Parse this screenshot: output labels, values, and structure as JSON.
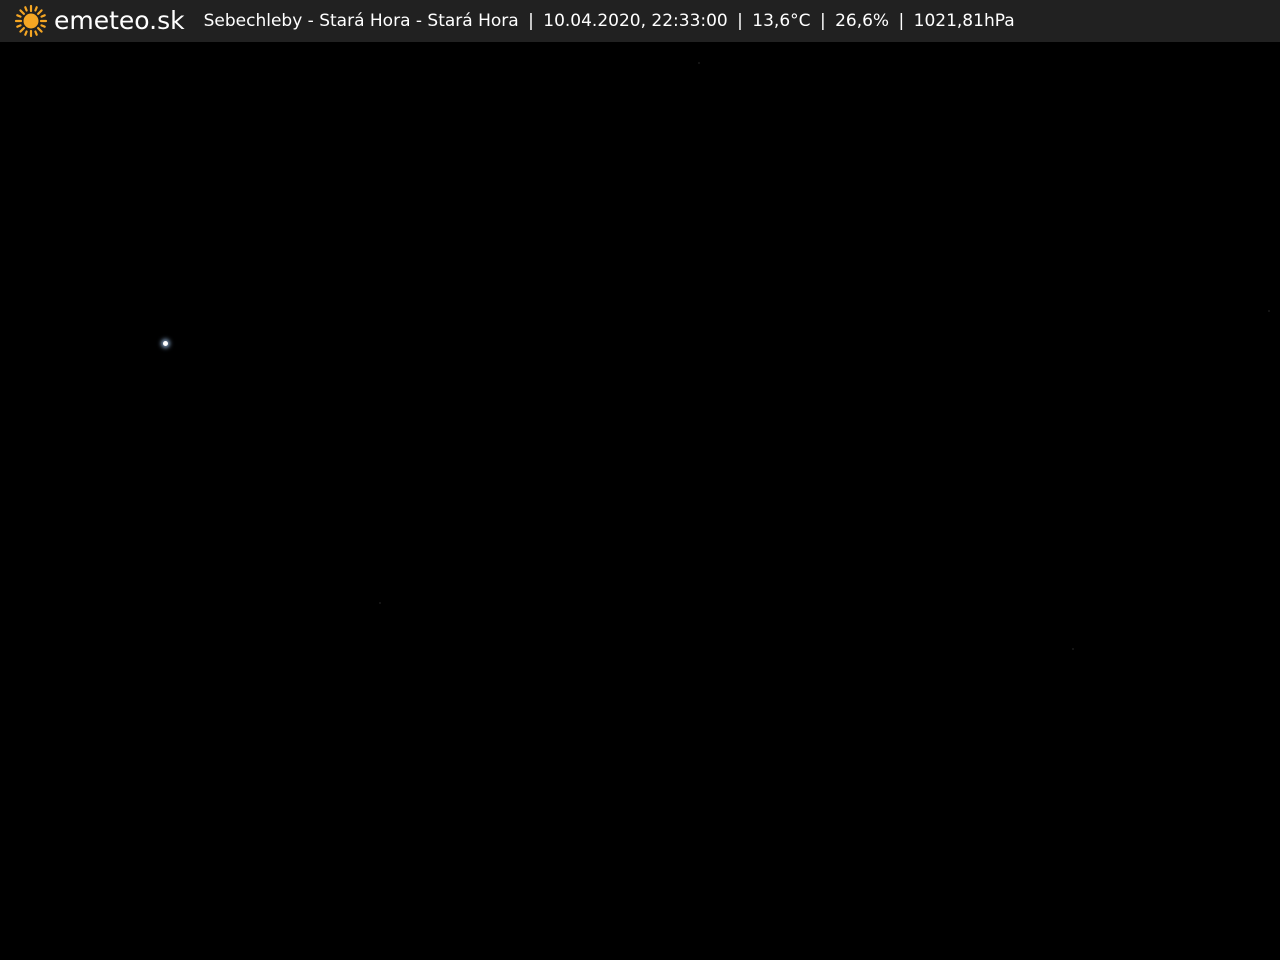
{
  "header": {
    "logo_icon": "sun-icon",
    "brand": "emeteo.sk",
    "location": "Sebechleby - Stará Hora - Stará Hora",
    "datetime": "10.04.2020, 22:33:00",
    "temperature": "13,6°C",
    "humidity": "26,6%",
    "pressure": "1021,81hPa",
    "separator": "|"
  },
  "colors": {
    "topbar_bg": "#212121",
    "text": "#ffffff",
    "sun": "#f5a623",
    "sky": "#000000"
  }
}
